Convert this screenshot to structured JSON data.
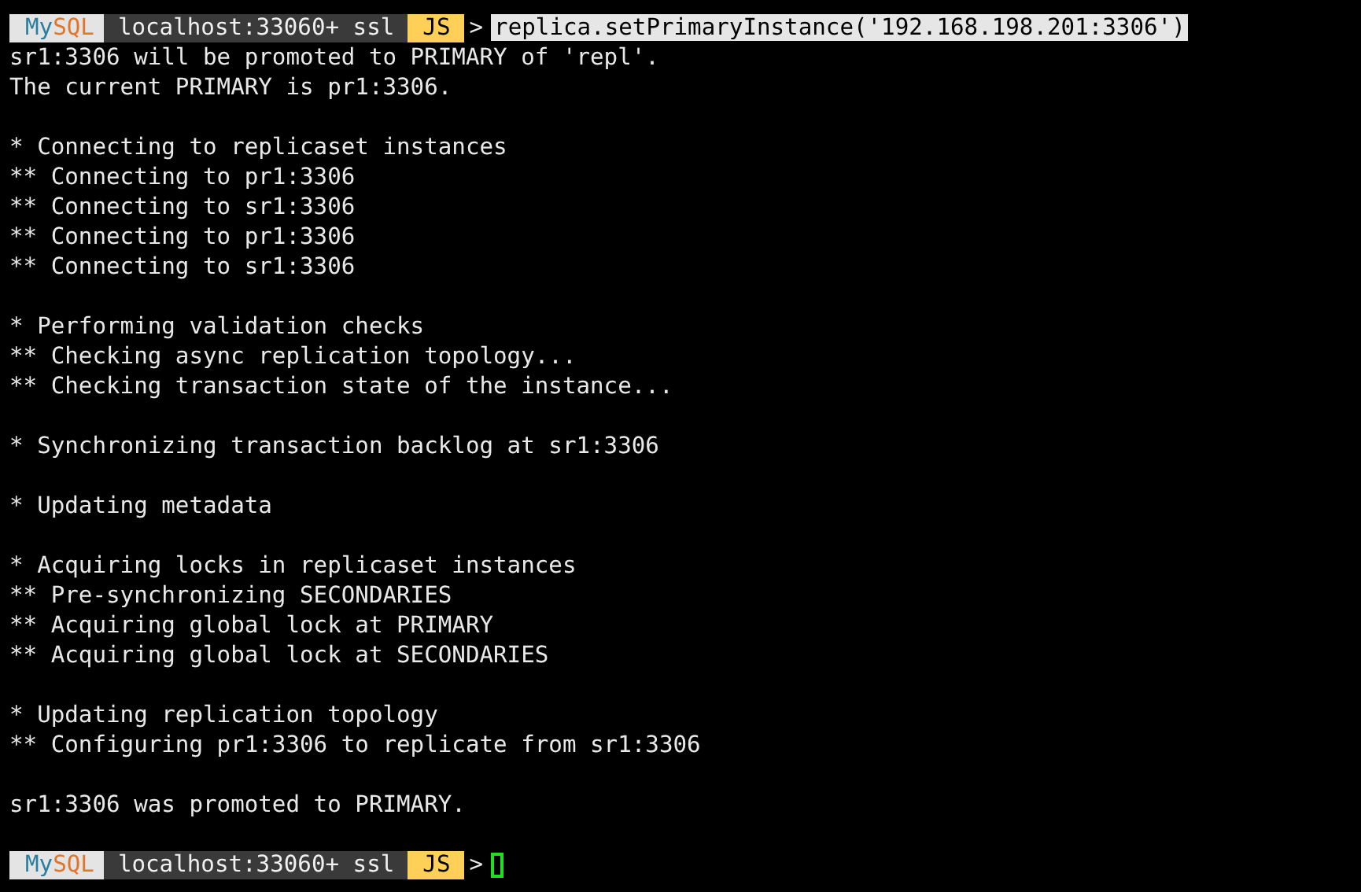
{
  "terminal": {
    "lines": [
      {
        "kind": "prompt",
        "logo": [
          {
            "text": "My",
            "color": "#2a7fa0"
          },
          {
            "text": "SQL",
            "color": "#e0762a"
          }
        ],
        "host": "localhost:33060+ ssl",
        "mode": "JS",
        "arrow": ">",
        "command": "replica.setPrimaryInstance('192.168.198.201:3306')",
        "command_selected": true,
        "cursor": false
      },
      {
        "kind": "text",
        "text": "sr1:3306 will be promoted to PRIMARY of 'repl'."
      },
      {
        "kind": "text",
        "text": "The current PRIMARY is pr1:3306."
      },
      {
        "kind": "blank"
      },
      {
        "kind": "text",
        "text": "* Connecting to replicaset instances"
      },
      {
        "kind": "text",
        "text": "** Connecting to pr1:3306"
      },
      {
        "kind": "text",
        "text": "** Connecting to sr1:3306"
      },
      {
        "kind": "text",
        "text": "** Connecting to pr1:3306"
      },
      {
        "kind": "text",
        "text": "** Connecting to sr1:3306"
      },
      {
        "kind": "blank"
      },
      {
        "kind": "text",
        "text": "* Performing validation checks"
      },
      {
        "kind": "text",
        "text": "** Checking async replication topology..."
      },
      {
        "kind": "text",
        "text": "** Checking transaction state of the instance..."
      },
      {
        "kind": "blank"
      },
      {
        "kind": "text",
        "text": "* Synchronizing transaction backlog at sr1:3306"
      },
      {
        "kind": "blank"
      },
      {
        "kind": "text",
        "text": "* Updating metadata"
      },
      {
        "kind": "blank"
      },
      {
        "kind": "text",
        "text": "* Acquiring locks in replicaset instances"
      },
      {
        "kind": "text",
        "text": "** Pre-synchronizing SECONDARIES"
      },
      {
        "kind": "text",
        "text": "** Acquiring global lock at PRIMARY"
      },
      {
        "kind": "text",
        "text": "** Acquiring global lock at SECONDARIES"
      },
      {
        "kind": "blank"
      },
      {
        "kind": "text",
        "text": "* Updating replication topology"
      },
      {
        "kind": "text",
        "text": "** Configuring pr1:3306 to replicate from sr1:3306"
      },
      {
        "kind": "blank"
      },
      {
        "kind": "text",
        "text": "sr1:3306 was promoted to PRIMARY."
      },
      {
        "kind": "blank"
      },
      {
        "kind": "prompt",
        "logo": [
          {
            "text": "My",
            "color": "#2a7fa0"
          },
          {
            "text": "SQL",
            "color": "#e0762a"
          }
        ],
        "host": "localhost:33060+ ssl",
        "mode": "JS",
        "arrow": ">",
        "cursor": true
      }
    ]
  }
}
